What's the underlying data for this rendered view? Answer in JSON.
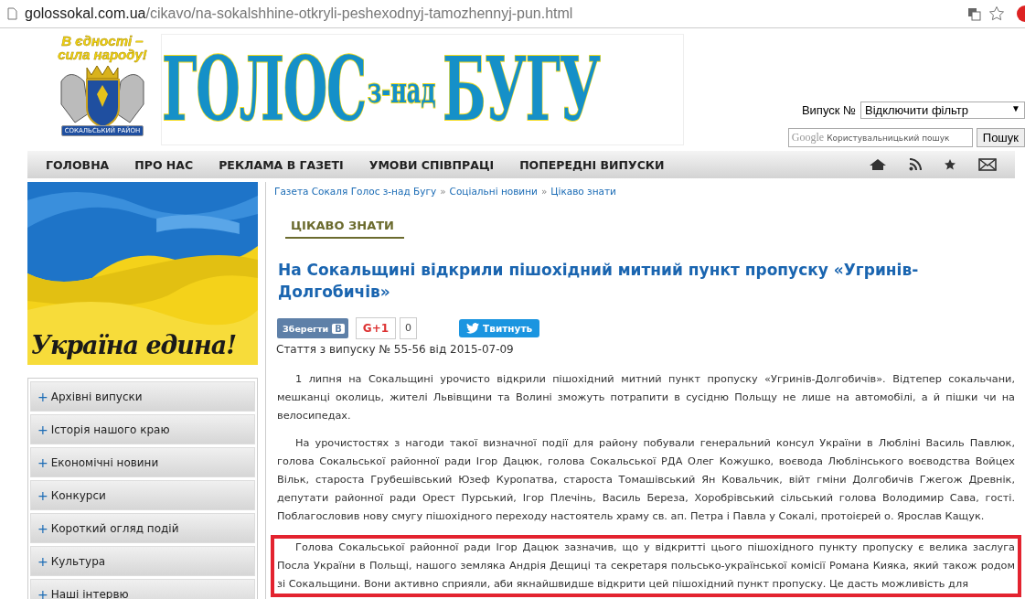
{
  "browser": {
    "url_host": "golossokal.com.ua",
    "url_path": "/cikavo/na-sokalshhine-otkryli-peshexodnyj-tamozhennyj-pun.html"
  },
  "header": {
    "slogan_line_1": "В єдності –",
    "slogan_line_2": "сила народу!",
    "crest_label": "СОКАЛЬСЬКИЙ РАЙОН",
    "title_first": "ГОЛОС",
    "title_middle": "з-над",
    "title_last": "БУГУ"
  },
  "issue_filter": {
    "label": "Випуск №",
    "value": "Відключити фільтр",
    "caret": "▼"
  },
  "search": {
    "brand": "Google",
    "placeholder": "Користувальницький пошук",
    "button": "Пошук"
  },
  "nav": {
    "items": [
      {
        "label": "ГОЛОВНА"
      },
      {
        "label": "ПРО НАС"
      },
      {
        "label": "РЕКЛАМА В ГАЗЕТІ"
      },
      {
        "label": "УМОВИ СПІВПРАЦІ"
      },
      {
        "label": "ПОПЕРЕДНІ ВИПУСКИ"
      }
    ],
    "icons": [
      {
        "kind": "home"
      },
      {
        "kind": "rss"
      },
      {
        "kind": "star"
      },
      {
        "kind": "mail"
      }
    ]
  },
  "banner": {
    "caption": "Україна едина!"
  },
  "sidebar": {
    "items": [
      {
        "icon": "+",
        "label": "Архівні випуски"
      },
      {
        "icon": "+",
        "label": "Історія нашого краю"
      },
      {
        "icon": "+",
        "label": "Економічні новини"
      },
      {
        "icon": "+",
        "label": "Конкурси"
      },
      {
        "icon": "+",
        "label": "Короткий огляд подій"
      },
      {
        "icon": "+",
        "label": "Культура"
      },
      {
        "icon": "+",
        "label": "Наші інтервю"
      }
    ]
  },
  "breadcrumbs": [
    {
      "label": "Газета Сокаля Голос з-над Бугу"
    },
    {
      "label": "Соціальні новини"
    },
    {
      "label": "Цікаво знати"
    }
  ],
  "breadcrumb_separator": "»",
  "category": "ЦІКАВО ЗНАТИ",
  "title": "На Сокальщині відкрили пішохідний митний пункт пропуску «Угринів-Долгобичів»",
  "share": {
    "vk_label": "Зберегти",
    "vk_icon": "В",
    "gplus_label": "G+1",
    "gplus_count": "0",
    "tweet_label": "Твитнуть"
  },
  "issue_line": "Стаття з випуску № 55-56 від 2015-07-09",
  "paragraphs": [
    {
      "highlighted": false,
      "text": "1 липня на Сокальщині урочисто відкрили пішохідний митний пункт пропуску «Угринів-Долгобичів». Відтепер сокальчани, мешканці околиць, жителі Львівщини та Волині зможуть потрапити в сусідню Польщу не лише на автомобілі, а й пішки чи на велосипедах."
    },
    {
      "highlighted": false,
      "text": "На урочистостях з нагоди такої визначної події для району побували генеральний консул України в Любліні Василь Павлюк, голова Сокальської районної ради Ігор Дацюк, голова Сокальської РДА Олег Кожушко, воєвода Люблінського воєводства Войцех Вільк, староста Грубешівський Юзеф Куропатва, староста Томашівський Ян Ковальчик, війт гміни Долгобичів Гжегож Древнік, депутати районної ради Орест Пурський, Ігор Плечінь, Василь Береза, Хоробрівський сільський голова Володимир Сава, гості. Поблагословив нову смугу пішохідного переходу настоятель храму св. ап. Петра і Павла у Сокалі, протоієрей о. Ярослав Кащук."
    },
    {
      "highlighted": true,
      "text": "Голова Сокальської районної ради Ігор Дацюк зазначив, що у відкритті цього пішохідного пункту пропуску є велика заслуга Посла України в Польщі, нашого земляка Андрія Дещиці та секретаря польсько-української комісії Романа Кияка, який також родом зі Сокальщини. Вони активно сприяли, аби якнайшвидше відкрити цей пішохідний пункт пропуску. Це дасть можливість для"
    }
  ]
}
